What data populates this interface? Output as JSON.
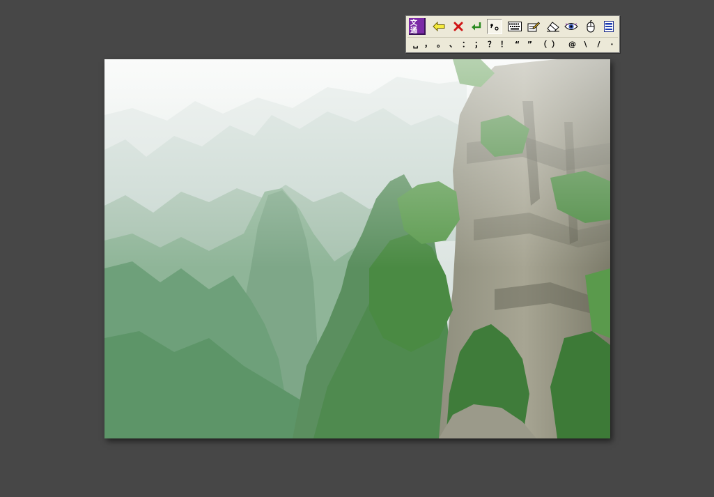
{
  "colors": {
    "desktop_background": "#474747",
    "toolbar_background": "#ece9d8",
    "logo_purple": "#7b2aa6",
    "cancel_red": "#d01515",
    "enter_green": "#2a8a20"
  },
  "photo": {
    "subject": "misty mountain landscape with cliffs and green trees"
  },
  "ime_toolbar": {
    "logo": {
      "top": "文通",
      "bottom": "WT"
    },
    "buttons": [
      {
        "icon": "back-arrow-icon"
      },
      {
        "icon": "cancel-x-icon"
      },
      {
        "icon": "enter-icon"
      },
      {
        "icon": "punctuation-mode-icon",
        "label": "，。",
        "pressed": true
      },
      {
        "icon": "keyboard-icon"
      },
      {
        "icon": "handwriting-pad-icon"
      },
      {
        "icon": "eraser-icon"
      },
      {
        "icon": "eye-icon"
      },
      {
        "icon": "mouse-icon"
      },
      {
        "icon": "menu-icon"
      }
    ],
    "punctuation": [
      "␣",
      "，",
      "。",
      "、",
      "：",
      "；",
      "？",
      "！",
      "“",
      "”",
      "（",
      "）",
      "@",
      "\\",
      "/",
      "·"
    ]
  }
}
